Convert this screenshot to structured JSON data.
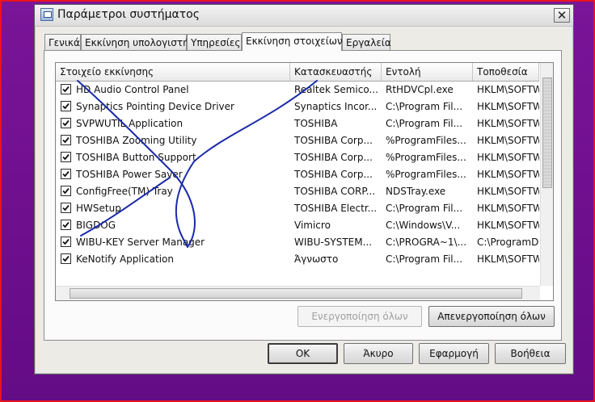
{
  "window": {
    "title": "Παράμετροι συστήματος",
    "close_glyph": "✕"
  },
  "tabs": [
    {
      "label": "Γενικά",
      "active": false
    },
    {
      "label": "Εκκίνηση υπολογιστή",
      "active": false
    },
    {
      "label": "Υπηρεσίες",
      "active": false
    },
    {
      "label": "Εκκίνηση στοιχείων",
      "active": true
    },
    {
      "label": "Εργαλεία",
      "active": false
    }
  ],
  "table": {
    "columns": [
      "Στοιχείο εκκίνησης",
      "Κατασκευαστής",
      "Εντολή",
      "Τοποθεσία"
    ],
    "rows": [
      {
        "checked": true,
        "item": "HD Audio Control Panel",
        "maker": "Realtek Semico...",
        "command": "RtHDVCpl.exe",
        "location": "HKLM\\SOFTW"
      },
      {
        "checked": true,
        "item": "Synaptics Pointing Device Driver",
        "maker": "Synaptics Incor...",
        "command": "C:\\Program Fil...",
        "location": "HKLM\\SOFTW"
      },
      {
        "checked": true,
        "item": "SVPWUTIL Application",
        "maker": "TOSHIBA",
        "command": "C:\\Program Fil...",
        "location": "HKLM\\SOFTW"
      },
      {
        "checked": true,
        "item": "TOSHIBA Zooming Utility",
        "maker": "TOSHIBA Corp...",
        "command": "%ProgramFiles...",
        "location": "HKLM\\SOFTW"
      },
      {
        "checked": true,
        "item": "TOSHIBA Button Support",
        "maker": "TOSHIBA Corp...",
        "command": "%ProgramFiles...",
        "location": "HKLM\\SOFTW"
      },
      {
        "checked": true,
        "item": "TOSHIBA Power Saver",
        "maker": "TOSHIBA Corp...",
        "command": "%ProgramFiles...",
        "location": "HKLM\\SOFTW"
      },
      {
        "checked": true,
        "item": "ConfigFree(TM) Tray",
        "maker": "TOSHIBA CORP...",
        "command": "NDSTray.exe",
        "location": "HKLM\\SOFTW"
      },
      {
        "checked": true,
        "item": "HWSetup",
        "maker": "TOSHIBA Electr...",
        "command": "C:\\Program Fil...",
        "location": "HKLM\\SOFTW"
      },
      {
        "checked": true,
        "item": "BIGDOG",
        "maker": "Vimicro",
        "command": "C:\\Windows\\V...",
        "location": "HKLM\\SOFTW"
      },
      {
        "checked": true,
        "item": "WIBU-KEY Server Manager",
        "maker": "WIBU-SYSTEM...",
        "command": "C:\\PROGRA~1\\...",
        "location": "C:\\ProgramD"
      },
      {
        "checked": true,
        "item": "KeNotify Application",
        "maker": "Άγνωστο",
        "command": "C:\\Program Fil...",
        "location": "HKLM\\SOFTW"
      }
    ]
  },
  "panel_buttons": {
    "enable_all": "Ενεργοποίηση όλων",
    "disable_all": "Απενεργοποίηση όλων"
  },
  "footer_buttons": {
    "ok": "OK",
    "cancel": "Άκυρο",
    "apply": "Εφαρμογή",
    "help": "Βοήθεια"
  },
  "colors": {
    "background": "#6f0c8e",
    "frame_border": "#e8141e",
    "scribble": "#1a2aa8"
  }
}
